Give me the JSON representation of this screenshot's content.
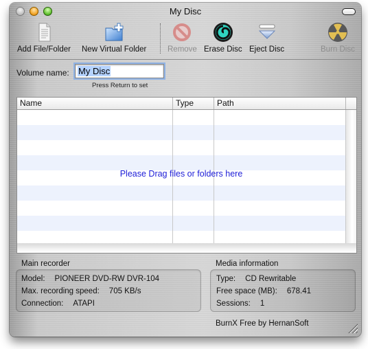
{
  "window": {
    "title": "My Disc"
  },
  "toolbar": {
    "items": [
      {
        "label": "Add File/Folder",
        "icon": "document-icon",
        "enabled": true
      },
      {
        "label": "New Virtual Folder",
        "icon": "folder-plus-icon",
        "enabled": true
      },
      {
        "label": "Remove",
        "icon": "prohibited-icon",
        "enabled": false
      },
      {
        "label": "Erase Disc",
        "icon": "erase-swirl-icon",
        "enabled": true
      },
      {
        "label": "Eject Disc",
        "icon": "eject-icon",
        "enabled": true
      },
      {
        "label": "Burn Disc",
        "icon": "radiation-icon",
        "enabled": false
      }
    ]
  },
  "volume": {
    "label": "Volume name:",
    "value": "My Disc",
    "hint": "Press Return to set"
  },
  "table": {
    "columns": [
      "Name",
      "Type",
      "Path"
    ],
    "rows": [],
    "empty_message": "Please Drag files or folders here"
  },
  "recorder": {
    "title": "Main recorder",
    "fields": [
      {
        "label": "Model:",
        "value": "PIONEER DVD-RW DVR-104"
      },
      {
        "label": "Max. recording speed:",
        "value": "705 KB/s"
      },
      {
        "label": "Connection:",
        "value": "ATAPI"
      }
    ]
  },
  "media": {
    "title": "Media information",
    "fields": [
      {
        "label": "Type:",
        "value": "CD Rewritable"
      },
      {
        "label": "Free space (MB):",
        "value": "678.41"
      },
      {
        "label": "Sessions:",
        "value": "1"
      }
    ]
  },
  "footer": {
    "credit": "BurnX Free by HernanSoft"
  },
  "colors": {
    "empty_message": "#2020d8",
    "row_stripe": "#edf2fd",
    "selection": "#b5d3ff"
  }
}
